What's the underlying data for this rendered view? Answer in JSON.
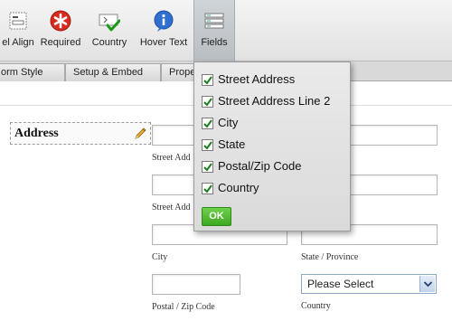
{
  "toolbar": {
    "buttons": [
      {
        "label": "el Align",
        "icon": "label-align-icon"
      },
      {
        "label": "Required",
        "icon": "required-asterisk-icon"
      },
      {
        "label": "Country",
        "icon": "country-check-icon"
      },
      {
        "label": "Hover Text",
        "icon": "info-icon"
      },
      {
        "label": "Fields",
        "icon": "fields-list-icon"
      }
    ]
  },
  "tabs": [
    "orm Style",
    "Setup & Embed",
    "Prope"
  ],
  "form": {
    "label": "Address",
    "sublabels": {
      "street": "Street Add",
      "street2": "Street Add",
      "city": "City",
      "state": "State / Province",
      "postal": "Postal / Zip Code",
      "country": "Country"
    },
    "country_select": "Please Select"
  },
  "popup": {
    "options": [
      {
        "label": "Street Address",
        "checked": true
      },
      {
        "label": "Street Address Line 2",
        "checked": true
      },
      {
        "label": "City",
        "checked": true
      },
      {
        "label": "State",
        "checked": true
      },
      {
        "label": "Postal/Zip Code",
        "checked": true
      },
      {
        "label": "Country",
        "checked": true
      }
    ],
    "ok_label": "OK"
  },
  "colors": {
    "required_red": "#d62b1f",
    "info_blue": "#2f6fd0",
    "ok_green": "#4cb52d",
    "check_green": "#1a7f1a"
  }
}
